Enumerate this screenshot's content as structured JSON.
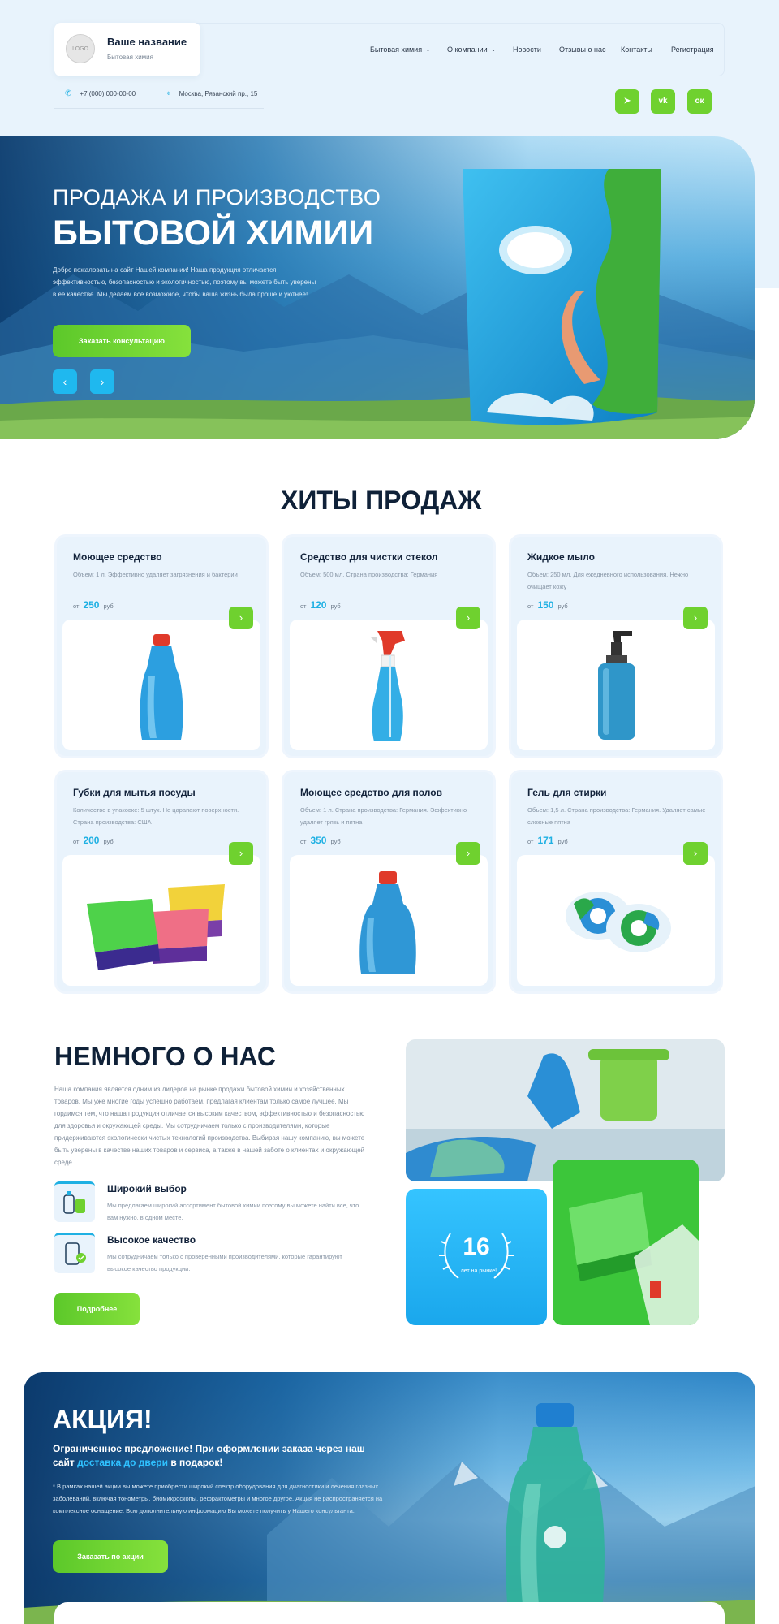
{
  "header": {
    "logo_text": "LOGO",
    "brand_name": "Ваше название",
    "brand_sub": "Бытовая химия",
    "nav": [
      {
        "label": "Бытовая химия",
        "dropdown": true
      },
      {
        "label": "О компании",
        "dropdown": true
      },
      {
        "label": "Новости",
        "dropdown": false
      },
      {
        "label": "Отзывы о нас",
        "dropdown": false
      },
      {
        "label": "Контакты",
        "dropdown": false
      },
      {
        "label": "Регистрация",
        "dropdown": false
      }
    ],
    "phone": "+7 (000) 000-00-00",
    "address": "Москва, Рязанский пр., 15",
    "phone_icon": "phone-icon",
    "address_icon": "map-pin-icon",
    "socials": [
      {
        "name": "telegram-icon",
        "glyph": "➤"
      },
      {
        "name": "vk-icon",
        "glyph": "vk"
      },
      {
        "name": "odnoklassniki-icon",
        "glyph": "ок"
      }
    ]
  },
  "hero": {
    "title_line1": "ПРОДАЖА И ПРОИЗВОДСТВО",
    "title_line2": "БЫТОВОЙ ХИМИИ",
    "description": "Добро пожаловать на сайт Нашей компании! Наша продукция отличается эффективностью, безопасностью и экологичностью, поэтому вы можете быть уверены в ее качестве. Мы делаем все возможное, чтобы ваша жизнь была проще и уютнее!",
    "cta": "Заказать консультацию",
    "prev_glyph": "‹",
    "next_glyph": "›"
  },
  "bestsellers": {
    "title": "ХИТЫ ПРОДАЖ",
    "price_prefix": "от",
    "currency": "руб",
    "go_glyph": "›",
    "products": [
      {
        "title": "Моющее средство",
        "desc": "Объем: 1 л. Эффективно удаляет загрязнения и бактерии",
        "price": "250"
      },
      {
        "title": "Средство для чистки стекол",
        "desc": "Объем: 500 мл. Страна производства: Германия",
        "price": "120"
      },
      {
        "title": "Жидкое мыло",
        "desc": "Объем: 250 мл. Для ежедневного использования. Нежно очищает кожу",
        "price": "150"
      },
      {
        "title": "Губки для мытья посуды",
        "desc": "Количество в упаковке: 5 штук. Не царапают поверхности. Страна производства: США",
        "price": "200"
      },
      {
        "title": "Моющее средство для полов",
        "desc": "Объем: 1 л. Страна производства: Германия. Эффективно удаляет грязь и пятна",
        "price": "350"
      },
      {
        "title": "Гель для стирки",
        "desc": "Объем: 1,5 л. Страна производства: Германия. Удаляет самые сложные пятна",
        "price": "171"
      }
    ]
  },
  "about": {
    "title": "НЕМНОГО О НАС",
    "text": "Наша компания является одним из лидеров на рынке продажи бытовой химии и хозяйственных товаров. Мы уже многие годы успешно работаем, предлагая клиентам только самое лучшее. Мы гордимся тем, что наша продукция отличается высоким качеством, эффективностью и безопасностью для здоровья и окружающей среды. Мы сотрудничаем только с производителями, которые придерживаются экологически чистых технологий производства. Выбирая нашу компанию, вы можете быть уверены в качестве наших товаров и сервиса, а также в нашей заботе о клиентах и окружающей среде.",
    "features": [
      {
        "title": "Широкий выбор",
        "desc": "Мы предлагаем широкий ассортимент бытовой химии поэтому вы можете найти все, что вам нужно, в одном месте.",
        "icon": "bottles-icon"
      },
      {
        "title": "Высокое качество",
        "desc": "Мы сотрудничаем только с проверенными производителями, которые гарантируют высокое качество продукции.",
        "icon": "quality-badge-icon"
      }
    ],
    "button": "Подробнее",
    "years_number": "16",
    "years_label": "...лет на рынке!"
  },
  "promo": {
    "title": "АКЦИЯ!",
    "lead_before": "Ограниченное предложение! При оформлении заказа через наш сайт ",
    "lead_highlight": "доставка до двери",
    "lead_after": " в подарок!",
    "note": "* В рамках нашей акции вы можете приобрести широкий спектр оборудования для диагностики и лечения глазных заболеваний, включая тонометры, биомикроскопы, рефрактометры и многое другое. Акция не распространяется на комплексное оснащение. Всю дополнительную информацию Вы можете получить у Нашего консультанта.",
    "cta": "Заказать по акции"
  },
  "colors": {
    "accent_green": "#6fd12f",
    "accent_blue": "#1fb0e3",
    "dark_text": "#13233b",
    "light_bg": "#e8f3fc"
  }
}
